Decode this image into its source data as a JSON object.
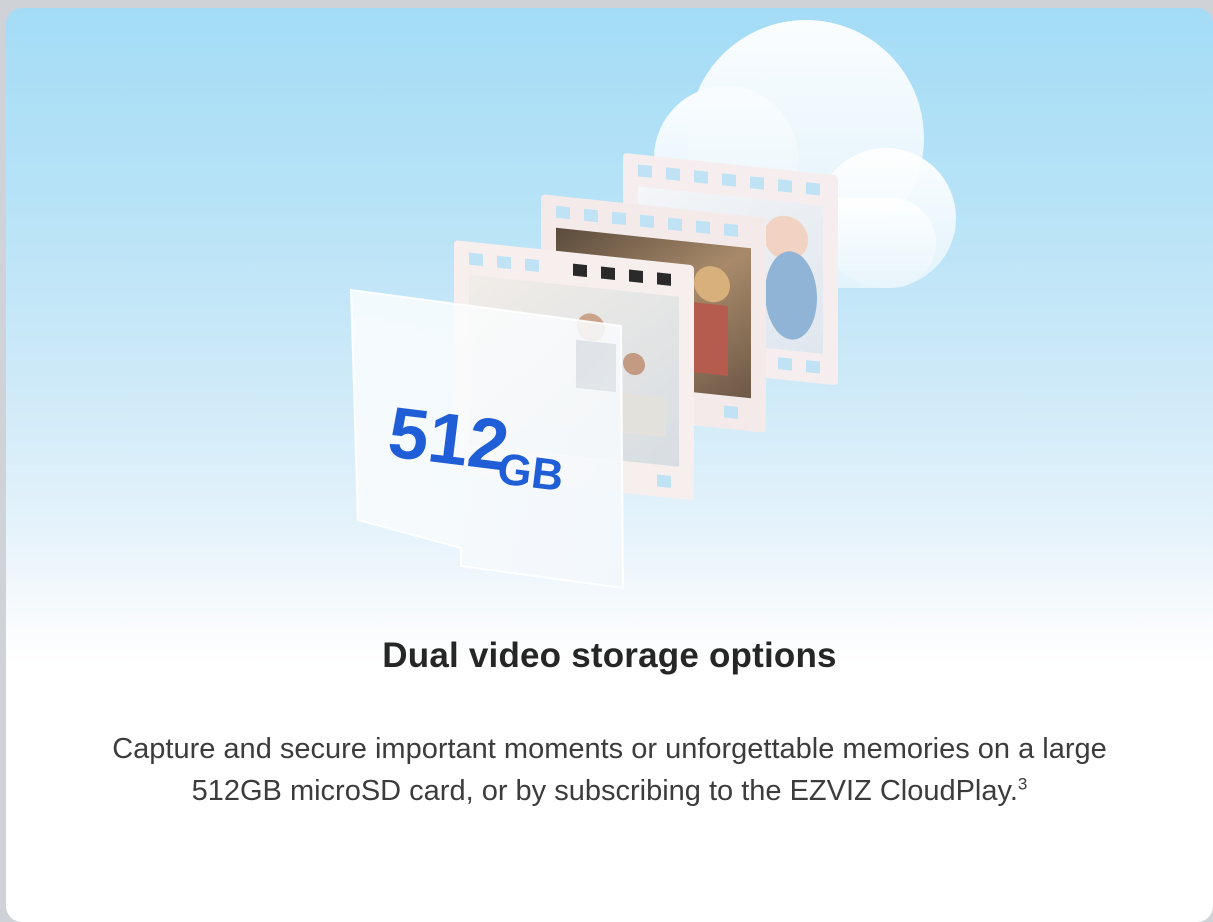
{
  "feature": {
    "title": "Dual video storage options",
    "description": "Capture and secure important moments or unforgettable memories on a large 512GB microSD card, or by subscribing to the EZVIZ CloudPlay.",
    "footnote_marker": "3"
  },
  "sd_card": {
    "capacity_number": "512",
    "capacity_unit": "GB"
  },
  "colors": {
    "sky_top": "#a4dcf6",
    "card_text_blue": "#1f5ed6",
    "title_text": "#262626",
    "body_text": "#3c3c3c"
  },
  "icons": [
    "cloud-icon",
    "film-strip-icon",
    "microsd-card-icon"
  ]
}
